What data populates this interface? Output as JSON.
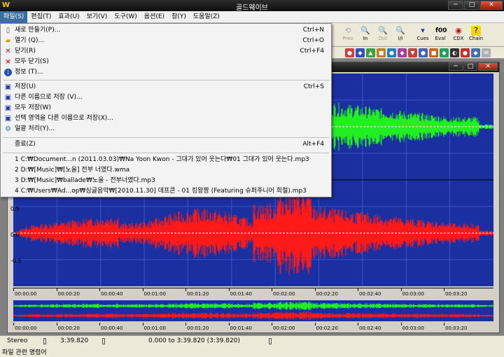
{
  "window": {
    "title": "골드웨이브",
    "min": "─",
    "max": "□",
    "close": "✕"
  },
  "menubar": [
    {
      "label": "파일(S)"
    },
    {
      "label": "편집(T)"
    },
    {
      "label": "효과(U)"
    },
    {
      "label": "보기(V)"
    },
    {
      "label": "도구(W)"
    },
    {
      "label": "옵션(E)"
    },
    {
      "label": "창(Y)"
    },
    {
      "label": "도움말(Z)"
    }
  ],
  "toolbar": {
    "prev": "Prev",
    "in": "In",
    "out": "Out",
    "inout": "I/I",
    "cues": "Cues",
    "eval": "Eval",
    "cdx": "CDX",
    "chain": "Chain"
  },
  "file_menu": {
    "items": [
      {
        "label": "새로 만들기(P)...",
        "shortcut": "Ctrl+N",
        "icon": "new-file-icon"
      },
      {
        "label": "열기 (Q)...",
        "shortcut": "Ctrl+O",
        "icon": "open-folder-icon"
      },
      {
        "label": "닫기(R)",
        "shortcut": "Ctrl+F4",
        "icon": "close-x-icon"
      },
      {
        "label": "모두 닫기(S)",
        "shortcut": "",
        "icon": "close-all-icon"
      },
      {
        "label": "정보 (T)...",
        "shortcut": "",
        "icon": "info-icon"
      },
      {
        "label": "저장(U)",
        "shortcut": "Ctrl+S",
        "icon": "save-icon"
      },
      {
        "label": "다른 이름으로 저장 (V)...",
        "shortcut": "",
        "icon": "save-as-icon"
      },
      {
        "label": "모두 저장(W)",
        "shortcut": "",
        "icon": "save-all-icon"
      },
      {
        "label": "선택 영역을 다른 이름으로 저장(X)...",
        "shortcut": "",
        "icon": "save-selection-icon"
      },
      {
        "label": "일괄 처리(Y)...",
        "shortcut": "",
        "icon": "batch-icon"
      },
      {
        "label": "종료(Z)",
        "shortcut": "Alt+F4",
        "icon": ""
      },
      {
        "label": "1 C:₩Document...n (2011.03.03)₩Na Yoon Kwon - 그대가 있어 웃는다₩01 그대가 있어 웃는다.mp3",
        "shortcut": "",
        "icon": ""
      },
      {
        "label": "2 D:₩[Music]₩[노을] 전부 너였다.wma",
        "shortcut": "",
        "icon": ""
      },
      {
        "label": "3 D:₩[Music]₩ballade₩노을 - 전부너였다.mp3",
        "shortcut": "",
        "icon": ""
      },
      {
        "label": "4 C:₩Users₩Ad...op₩싱글음악₩[2010.11.30] 데프콘 - 01 킹왕짱 (Featuring 슈퍼주니어 희철).mp3",
        "shortcut": "",
        "icon": ""
      }
    ]
  },
  "waveform": {
    "y_labels": [
      "0.5",
      "0.0",
      "-0.5"
    ],
    "top_channel_color": "#22ee22",
    "bottom_channel_color": "#ff1a1a",
    "background": "#1a2fa0"
  },
  "ruler": {
    "ticks": [
      "00:00:00",
      "00:00:20",
      "00:00:40",
      "00:01:00",
      "00:01:20",
      "00:01:40",
      "00:02:00",
      "00:02:20",
      "00:02:40",
      "00:03:00",
      "00:03:20"
    ]
  },
  "status": {
    "channels": "Stereo",
    "length": "3:39.820",
    "selection": "0.000 to 3:39.820 (3:39.820)",
    "hint": "파일 관련 명령어"
  }
}
